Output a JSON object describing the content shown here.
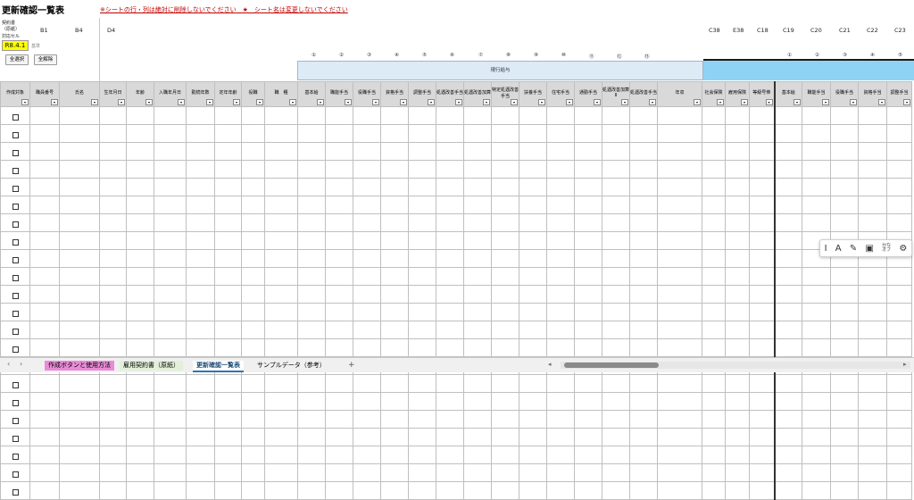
{
  "sheet": {
    "title": "更新確認一覧表",
    "warning_rows": "※シートの行・列は絶対に削除しないでください",
    "warning_name": "★　シート名は変更しないでください",
    "keiyaku_label": "契約書",
    "genshi_label": "（原紙）",
    "taiou_label": "対応セル",
    "version_cell": "R8.4.1",
    "sheet_small_label": "基準",
    "select_all": "全選択",
    "deselect_all": "全解除",
    "col_tags": [
      "B1",
      "B4",
      "D4",
      "C38",
      "E38",
      "C18",
      "C19",
      "C20",
      "C21",
      "C22",
      "C23"
    ],
    "circled_left": [
      "①",
      "②",
      "③",
      "④",
      "⑤",
      "⑥",
      "⑦",
      "⑧",
      "⑨",
      "⑩",
      "⑪",
      "⑫",
      "⑬"
    ],
    "circled_right": [
      "①",
      "②",
      "③",
      "④",
      "⑤"
    ],
    "band_label": "現行給与"
  },
  "headers": [
    "作成対象",
    "職員番号",
    "氏名",
    "生年月日",
    "年齢",
    "入職年月日",
    "勤続年数",
    "定年年齢",
    "役職",
    "職　種",
    "基本給",
    "職能手当",
    "役職手当",
    "資格手当",
    "調整手当",
    "処遇改善手当",
    "処遇改善加算",
    "特定処遇改善手当",
    "扶養手当",
    "住宅手当",
    "通勤手当",
    "処遇改善加算Ⅱ",
    "処遇改善手当",
    "年収",
    "社会保険",
    "雇用保険",
    "等級号俸",
    "基本給",
    "職能手当",
    "役職手当",
    "資格手当",
    "調整手当"
  ],
  "tabs": {
    "tab1": "作成ボタンと使用方法",
    "tab2": "雇用契約書（原紙）",
    "tab3": "更新確認一覧表",
    "tab4": "サンプルデータ（参考）",
    "add": "+"
  },
  "colors": {
    "pink": "#f8cce8",
    "green": "#ddf0d0",
    "band_light": "#ddebf7",
    "band_blue": "#8ed3f4",
    "warning": "#c00000",
    "tab_magenta": "#e98bd8"
  },
  "rows_visible": 22
}
